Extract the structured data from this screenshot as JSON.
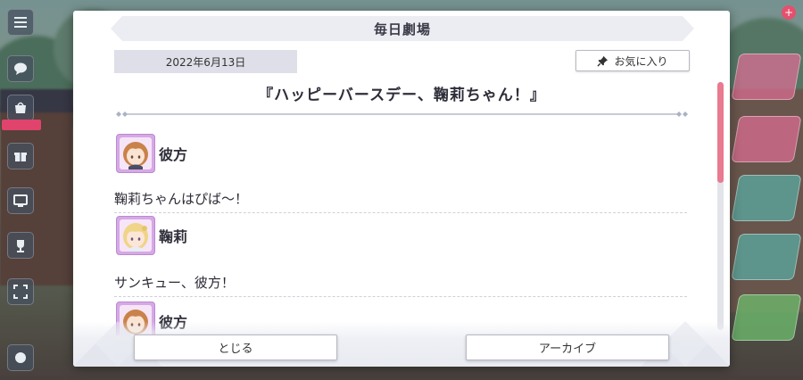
{
  "modal": {
    "title": "毎日劇場",
    "date": "2022年6月13日",
    "favorite_label": "お気に入り",
    "episode_title": "『ハッピーバースデー、鞠莉ちゃん！』"
  },
  "dialogue": [
    {
      "speaker": "彼方",
      "avatar_icon": "kanata-avatar-icon",
      "text": "鞠莉ちゃんはぴば〜！"
    },
    {
      "speaker": "鞠莉",
      "avatar_icon": "mari-avatar-icon",
      "text": "サンキュー、彼方！"
    },
    {
      "speaker": "彼方",
      "avatar_icon": "kanata-avatar-icon",
      "text": ""
    }
  ],
  "footer": {
    "close_label": "とじる",
    "archive_label": "アーカイブ"
  },
  "colors": {
    "scroll_thumb": "#e97a8f",
    "avatar_frame": "#d6a8e6",
    "title_bar": "#ecedf2"
  }
}
